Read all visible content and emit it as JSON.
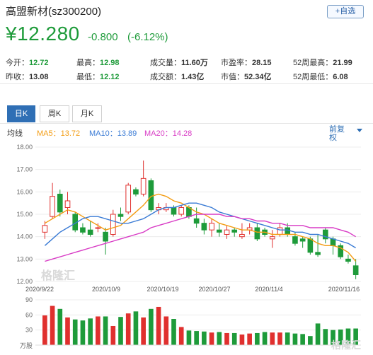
{
  "header": {
    "title": "高盟新材(sz300200)",
    "add_button": "+自选",
    "price": "¥12.280",
    "change": "-0.800",
    "change_pct": "(-6.12%)"
  },
  "stats": [
    {
      "label": "今开：",
      "value": "12.72",
      "tone": "g"
    },
    {
      "label": "最高：",
      "value": "12.98",
      "tone": "g"
    },
    {
      "label": "成交量：",
      "value": "11.60万",
      "tone": ""
    },
    {
      "label": "市盈率：",
      "value": "28.15",
      "tone": ""
    },
    {
      "label": "52周最高：",
      "value": "21.99",
      "tone": ""
    },
    {
      "label": "昨收：",
      "value": "13.08",
      "tone": ""
    },
    {
      "label": "最低：",
      "value": "12.12",
      "tone": "g"
    },
    {
      "label": "成交额：",
      "value": "1.43亿",
      "tone": ""
    },
    {
      "label": "市值：",
      "value": "52.34亿",
      "tone": ""
    },
    {
      "label": "52周最低：",
      "value": "6.08",
      "tone": ""
    }
  ],
  "tabs": [
    "日K",
    "周K",
    "月K"
  ],
  "legend": {
    "label": "均线",
    "ma5": "MA5：13.72",
    "ma10": "MA10：13.89",
    "ma20": "MA20：14.28",
    "adjust": "前复权"
  },
  "colors": {
    "up": "#e0302e",
    "down": "#1e9b3a",
    "ma5": "#f39c12",
    "ma10": "#3a7bd5",
    "ma20": "#d83bc5",
    "accent": "#2f6fb5"
  },
  "watermark": "格隆汇",
  "chart_data": {
    "type": "candlestick",
    "price_axis": {
      "ticks": [
        "18.00",
        "17.00",
        "16.00",
        "15.00",
        "14.00",
        "13.00",
        "12.00"
      ],
      "range": [
        12,
        18
      ]
    },
    "x_labels": [
      "2020/9/22",
      "2020/10/9",
      "2020/10/19",
      "2020/10/27",
      "2020/11/4",
      "2020/11/16"
    ],
    "candles": [
      {
        "o": 14.2,
        "c": 14.5,
        "h": 14.7,
        "l": 13.9
      },
      {
        "o": 14.9,
        "c": 15.8,
        "h": 16.4,
        "l": 14.8
      },
      {
        "o": 15.9,
        "c": 15.1,
        "h": 16.1,
        "l": 14.9
      },
      {
        "o": 15.3,
        "c": 15.6,
        "h": 16.0,
        "l": 15.0
      },
      {
        "o": 15.0,
        "c": 14.3,
        "h": 15.1,
        "l": 14.2
      },
      {
        "o": 14.4,
        "c": 14.2,
        "h": 14.6,
        "l": 14.1
      },
      {
        "o": 14.3,
        "c": 14.1,
        "h": 14.7,
        "l": 14.0
      },
      {
        "o": 14.4,
        "c": 14.4,
        "h": 14.6,
        "l": 14.2
      },
      {
        "o": 14.2,
        "c": 13.8,
        "h": 14.4,
        "l": 13.2
      },
      {
        "o": 14.1,
        "c": 15.0,
        "h": 15.2,
        "l": 14.0
      },
      {
        "o": 15.0,
        "c": 14.9,
        "h": 15.3,
        "l": 14.7
      },
      {
        "o": 15.1,
        "c": 16.3,
        "h": 16.4,
        "l": 15.0
      },
      {
        "o": 16.1,
        "c": 15.9,
        "h": 16.2,
        "l": 15.8
      },
      {
        "o": 15.9,
        "c": 16.6,
        "h": 17.4,
        "l": 15.8
      },
      {
        "o": 16.5,
        "c": 15.2,
        "h": 16.6,
        "l": 15.1
      },
      {
        "o": 15.2,
        "c": 15.3,
        "h": 15.5,
        "l": 15.0
      },
      {
        "o": 15.2,
        "c": 15.3,
        "h": 15.5,
        "l": 15.1
      },
      {
        "o": 15.3,
        "c": 15.0,
        "h": 15.4,
        "l": 14.9
      },
      {
        "o": 15.0,
        "c": 15.3,
        "h": 15.4,
        "l": 14.9
      },
      {
        "o": 15.3,
        "c": 14.9,
        "h": 15.4,
        "l": 14.8
      },
      {
        "o": 14.8,
        "c": 14.6,
        "h": 15.3,
        "l": 14.4
      },
      {
        "o": 14.6,
        "c": 14.3,
        "h": 14.8,
        "l": 14.1
      },
      {
        "o": 14.3,
        "c": 14.6,
        "h": 14.8,
        "l": 14.0
      },
      {
        "o": 14.3,
        "c": 14.2,
        "h": 14.6,
        "l": 14.0
      },
      {
        "o": 14.1,
        "c": 14.3,
        "h": 14.5,
        "l": 13.9
      },
      {
        "o": 14.3,
        "c": 14.2,
        "h": 14.4,
        "l": 14.0
      },
      {
        "o": 14.0,
        "c": 14.1,
        "h": 14.6,
        "l": 13.9
      },
      {
        "o": 14.3,
        "c": 14.4,
        "h": 14.6,
        "l": 14.1
      },
      {
        "o": 14.4,
        "c": 13.9,
        "h": 14.6,
        "l": 13.8
      },
      {
        "o": 14.3,
        "c": 14.1,
        "h": 14.4,
        "l": 14.0
      },
      {
        "o": 13.9,
        "c": 14.0,
        "h": 14.3,
        "l": 13.5
      },
      {
        "o": 14.1,
        "c": 14.4,
        "h": 14.6,
        "l": 14.0
      },
      {
        "o": 14.4,
        "c": 14.1,
        "h": 14.6,
        "l": 14.0
      },
      {
        "o": 14.0,
        "c": 13.7,
        "h": 14.2,
        "l": 13.6
      },
      {
        "o": 13.9,
        "c": 13.8,
        "h": 14.0,
        "l": 13.5
      },
      {
        "o": 13.9,
        "c": 13.3,
        "h": 14.0,
        "l": 13.2
      },
      {
        "o": 13.3,
        "c": 13.2,
        "h": 14.1,
        "l": 13.1
      },
      {
        "o": 14.3,
        "c": 13.9,
        "h": 14.4,
        "l": 13.7
      },
      {
        "o": 13.9,
        "c": 13.6,
        "h": 14.0,
        "l": 13.2
      },
      {
        "o": 13.6,
        "c": 13.1,
        "h": 13.7,
        "l": 13.0
      },
      {
        "o": 13.0,
        "c": 12.9,
        "h": 13.2,
        "l": 12.8
      },
      {
        "o": 12.7,
        "c": 12.3,
        "h": 13.0,
        "l": 12.1
      }
    ],
    "ma5": [
      14.6,
      14.8,
      15.0,
      15.2,
      15.1,
      14.9,
      14.7,
      14.5,
      14.3,
      14.4,
      14.5,
      14.8,
      15.1,
      15.4,
      15.8,
      15.9,
      15.8,
      15.6,
      15.5,
      15.3,
      15.1,
      15.0,
      14.8,
      14.6,
      14.5,
      14.4,
      14.3,
      14.3,
      14.2,
      14.2,
      14.1,
      14.1,
      14.1,
      14.1,
      14.0,
      13.9,
      13.7,
      13.6,
      13.6,
      13.5,
      13.3,
      12.9
    ],
    "ma10": [
      13.6,
      13.9,
      14.2,
      14.4,
      14.6,
      14.8,
      14.9,
      14.9,
      14.8,
      14.7,
      14.6,
      14.6,
      14.7,
      14.8,
      15.0,
      15.2,
      15.3,
      15.3,
      15.4,
      15.5,
      15.5,
      15.4,
      15.3,
      15.1,
      15.0,
      14.9,
      14.8,
      14.7,
      14.6,
      14.5,
      14.4,
      14.3,
      14.3,
      14.2,
      14.2,
      14.1,
      14.1,
      14.0,
      13.9,
      13.8,
      13.7,
      13.5
    ],
    "ma20": [
      12.9,
      13.0,
      13.1,
      13.2,
      13.3,
      13.4,
      13.5,
      13.6,
      13.7,
      13.8,
      13.9,
      14.0,
      14.1,
      14.2,
      14.4,
      14.5,
      14.6,
      14.7,
      14.8,
      14.9,
      15.0,
      15.0,
      15.0,
      15.0,
      14.9,
      14.9,
      14.8,
      14.8,
      14.7,
      14.7,
      14.6,
      14.6,
      14.5,
      14.5,
      14.5,
      14.4,
      14.4,
      14.4,
      14.4,
      14.3,
      14.2,
      14.0
    ],
    "volume_axis": {
      "ticks": [
        "90",
        "60",
        "30"
      ],
      "unit": "万股",
      "range": [
        0,
        90
      ]
    },
    "volumes": [
      59,
      78,
      72,
      55,
      51,
      49,
      53,
      57,
      57,
      38,
      56,
      63,
      67,
      55,
      72,
      76,
      57,
      52,
      36,
      29,
      28,
      27,
      25,
      26,
      24,
      24,
      21,
      23,
      24,
      26,
      25,
      25,
      25,
      23,
      22,
      18,
      43,
      32,
      30,
      31,
      33,
      33
    ]
  }
}
